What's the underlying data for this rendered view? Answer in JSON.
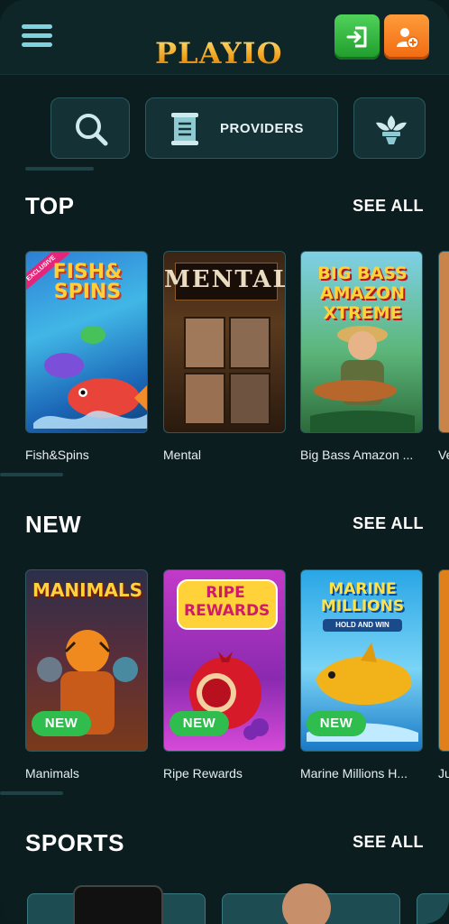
{
  "header": {
    "logo_text": "PLAYIO",
    "menu_icon": "hamburger-icon",
    "login_icon": "login-icon",
    "register_icon": "add-user-icon",
    "colors": {
      "login": "#2fb53c",
      "register": "#f57c1f",
      "accent": "#7fd3e0"
    }
  },
  "filters": {
    "search_icon": "search-icon",
    "providers_label": "PROVIDERS",
    "providers_icon": "scroll-icon",
    "more_icon": "fleur-icon"
  },
  "sections": {
    "top": {
      "title": "TOP",
      "see_all": "SEE ALL",
      "games": [
        {
          "name": "Fish&Spins",
          "art": "FISH& SPINS",
          "badge": "EXCLUSIVE"
        },
        {
          "name": "Mental",
          "art": "MENTAL"
        },
        {
          "name": "Big Bass Amazon ...",
          "art": "BIG BASS AMAZON XTREME"
        },
        {
          "name": "Ve"
        }
      ]
    },
    "new": {
      "title": "NEW",
      "see_all": "SEE ALL",
      "games": [
        {
          "name": "Manimals",
          "art": "MANIMALS",
          "badge": "NEW"
        },
        {
          "name": "Ripe Rewards",
          "art": "RIPE REWARDS",
          "badge": "NEW"
        },
        {
          "name": "Marine Millions H...",
          "art": "MARINE MILLIONS",
          "art_sub": "HOLD AND WIN",
          "badge": "NEW"
        },
        {
          "name": "Ju"
        }
      ]
    },
    "sports": {
      "title": "SPORTS",
      "see_all": "SEE ALL"
    }
  }
}
